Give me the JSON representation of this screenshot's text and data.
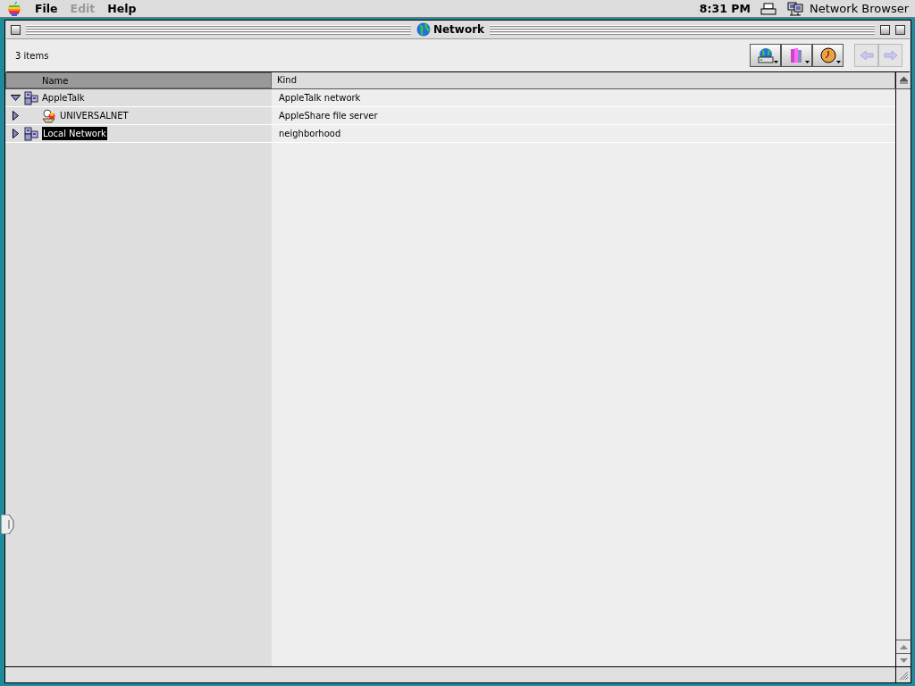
{
  "menu_bar": {
    "menus": [
      {
        "label": "File",
        "disabled": false
      },
      {
        "label": "Edit",
        "disabled": true
      },
      {
        "label": "Help",
        "disabled": false
      }
    ],
    "clock": "8:31 PM",
    "app_name": "Network Browser"
  },
  "window": {
    "title": "Network"
  },
  "toolbar": {
    "item_count": "3 items",
    "back": {
      "disabled": true
    },
    "forward": {
      "disabled": true
    }
  },
  "table": {
    "columns": [
      {
        "label": "Name",
        "sorted": true
      },
      {
        "label": "Kind",
        "sorted": false
      }
    ],
    "rows": [
      {
        "name": "AppleTalk",
        "kind_label": "AppleTalk network",
        "kind": "network",
        "expanded": true,
        "selected": false,
        "children": [
          {
            "name": "UNIVERSALNET",
            "kind_label": "AppleShare file server",
            "kind": "server",
            "expanded": false,
            "selected": false
          }
        ]
      },
      {
        "name": "Local Network",
        "kind_label": "neighborhood",
        "kind": "network",
        "expanded": false,
        "selected": true
      }
    ]
  }
}
